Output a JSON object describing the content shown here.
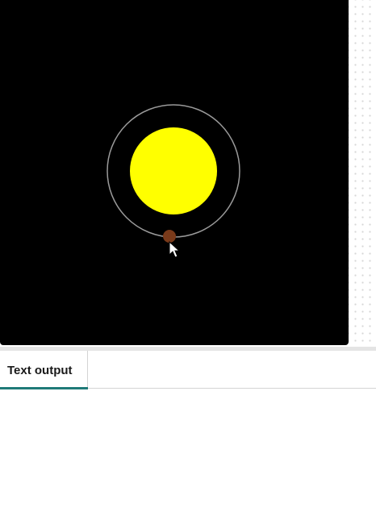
{
  "simulation": {
    "sun_color": "#ffff00",
    "orbit_color": "#9a9a9a",
    "planet_color": "#7a3a1a",
    "background_color": "#000000"
  },
  "cursor": {
    "icon": "mouse-pointer-icon"
  },
  "tabs": [
    {
      "label": "Text output",
      "active": true
    }
  ],
  "accent_color": "#1f7a78",
  "output": {
    "text": ""
  }
}
